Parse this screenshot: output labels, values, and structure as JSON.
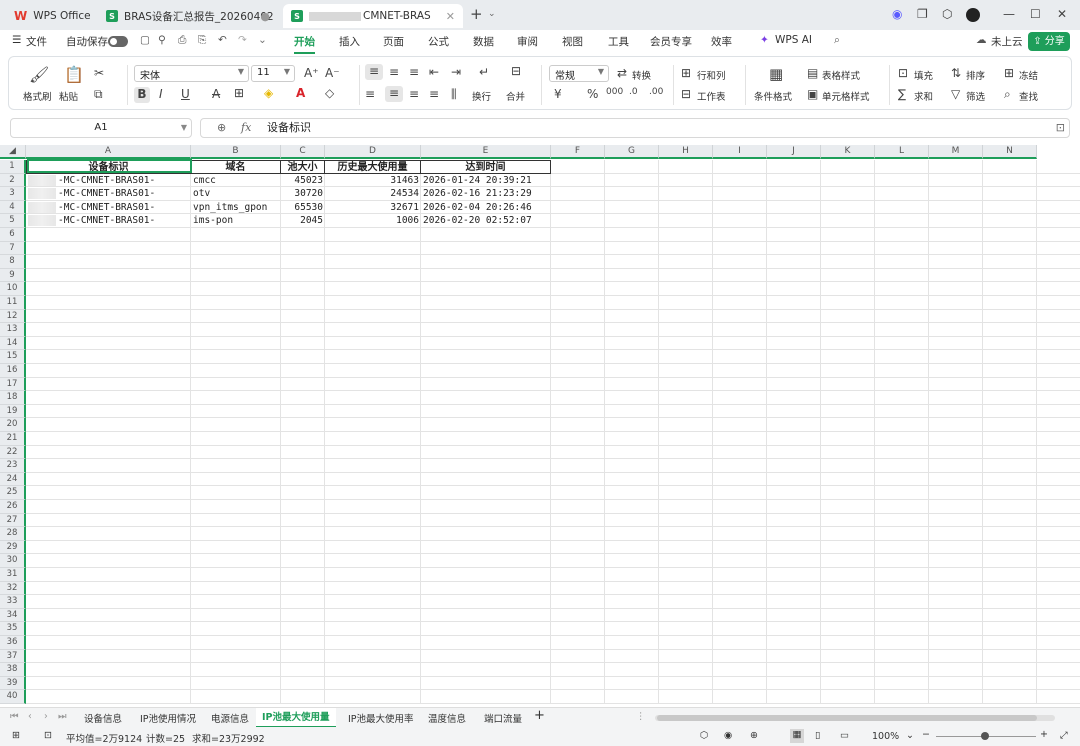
{
  "titlebar": {
    "app_tab": "WPS Office",
    "tabs": [
      {
        "label": "BRAS设备汇总报告_20260402"
      },
      {
        "label": "CMNET-BRAS"
      }
    ],
    "new_tab": "+"
  },
  "menubar": {
    "file": "文件",
    "autosave": "自动保存",
    "items": [
      "开始",
      "插入",
      "页面",
      "公式",
      "数据",
      "审阅",
      "视图",
      "工具",
      "会员专享",
      "效率",
      "WPS AI"
    ],
    "cloud": "未上云",
    "share": "分享"
  },
  "ribbon": {
    "format_painter": "格式刷",
    "paste": "粘贴",
    "font_name": "宋体",
    "font_size": "11",
    "number_format": "常规",
    "convert": "转换",
    "row_col": "行和列",
    "worksheet": "工作表",
    "cond_format": "条件格式",
    "table_style": "表格样式",
    "cell_style": "单元格样式",
    "fill": "填充",
    "sort": "排序",
    "freeze": "冻结",
    "sum": "求和",
    "filter": "筛选",
    "find": "查找",
    "wrap": "换行",
    "merge": "合并"
  },
  "formula": {
    "cell_ref": "A1",
    "content": "设备标识"
  },
  "grid": {
    "columns": [
      "A",
      "B",
      "C",
      "D",
      "E",
      "F",
      "G",
      "H",
      "I",
      "J",
      "K",
      "L",
      "M",
      "N"
    ],
    "header_row": [
      "设备标识",
      "域名",
      "池大小",
      "历史最大使用量",
      "达到时间"
    ],
    "rows": [
      {
        "device": "-MC-CMNET-BRAS01-",
        "domain": "cmcc",
        "pool": "45023",
        "max": "31463",
        "time": "2026-01-24 20:39:21"
      },
      {
        "device": "-MC-CMNET-BRAS01-",
        "domain": "otv",
        "pool": "30720",
        "max": "24534",
        "time": "2026-02-16 21:23:29"
      },
      {
        "device": "-MC-CMNET-BRAS01-",
        "domain": "vpn_itms_gpon",
        "pool": "65530",
        "max": "32671",
        "time": "2026-02-04 20:26:46"
      },
      {
        "device": "-MC-CMNET-BRAS01-",
        "domain": "ims-pon",
        "pool": "2045",
        "max": "1006",
        "time": "2026-02-20 02:52:07"
      }
    ],
    "row_count": 40
  },
  "sheets": [
    "设备信息",
    "IP池使用情况",
    "电源信息",
    "IP池最大使用量",
    "IP池最大使用率",
    "温度信息",
    "端口流量"
  ],
  "active_sheet": 3,
  "status": {
    "average": "平均值=2万9124",
    "count": "计数=25",
    "sum": "求和=23万2992",
    "zoom": "100%"
  },
  "colors": {
    "accent": "#1e9e5a"
  }
}
